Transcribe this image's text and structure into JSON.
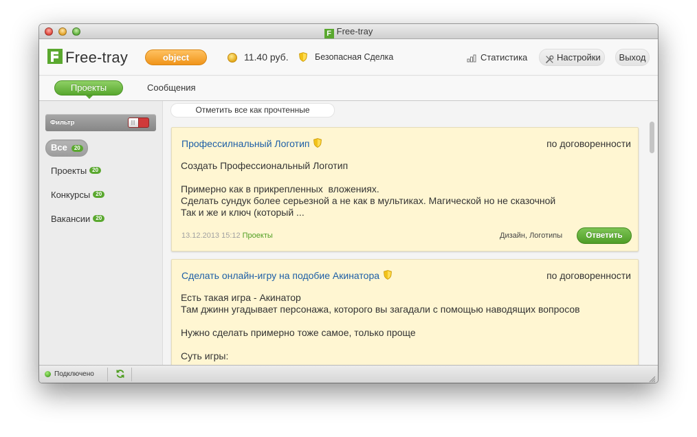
{
  "window": {
    "title": "Free-tray",
    "logo_letter": "F"
  },
  "header": {
    "logo_text": "Free-tray",
    "user_button": "object",
    "balance": "11.40 руб.",
    "safe_deal": "Безопасная Сделка",
    "stats": "Статистика",
    "settings": "Настройки",
    "logout": "Выход"
  },
  "tabs": {
    "projects": "Проекты",
    "messages": "Сообщения"
  },
  "sidebar": {
    "filter_label": "Фильтр",
    "items": [
      {
        "label": "Все",
        "count": "20"
      },
      {
        "label": "Проекты",
        "count": "20"
      },
      {
        "label": "Конкурсы",
        "count": "20"
      },
      {
        "label": "Вакансии",
        "count": "20"
      }
    ]
  },
  "main": {
    "mark_read": "Отметить все как прочтенные",
    "cards": [
      {
        "title": "Профессилнальный Логотип",
        "price": "по договоренности",
        "body": "Создать Профессиональный Логотип\n\nПримерно как в прикрепленных  вложениях.\nСделать сундук более серьезной а не как в мультиках. Магической но не сказочной\nТак и же и ключ (который ...",
        "date": "13.12.2013 15:12",
        "category": "Проекты",
        "tags": "Дизайн, Логотипы",
        "reply": "Ответить"
      },
      {
        "title": "Сделать онлайн-игру на подобие Акинатора",
        "price": "по договоренности",
        "body": "Есть такая игра - Акинатор\nТам джинн угадывает персонажа, которого вы загадали с помощью наводящих вопросов\n\nНужно сделать примерно тоже самое, только проще\n\nСуть игры:"
      }
    ]
  },
  "statusbar": {
    "status": "Подключено"
  },
  "colors": {
    "accent_green": "#5aa82f",
    "user_orange": "#f0941a",
    "card_bg": "#fff6d2",
    "link_blue": "#1c5ea6"
  }
}
